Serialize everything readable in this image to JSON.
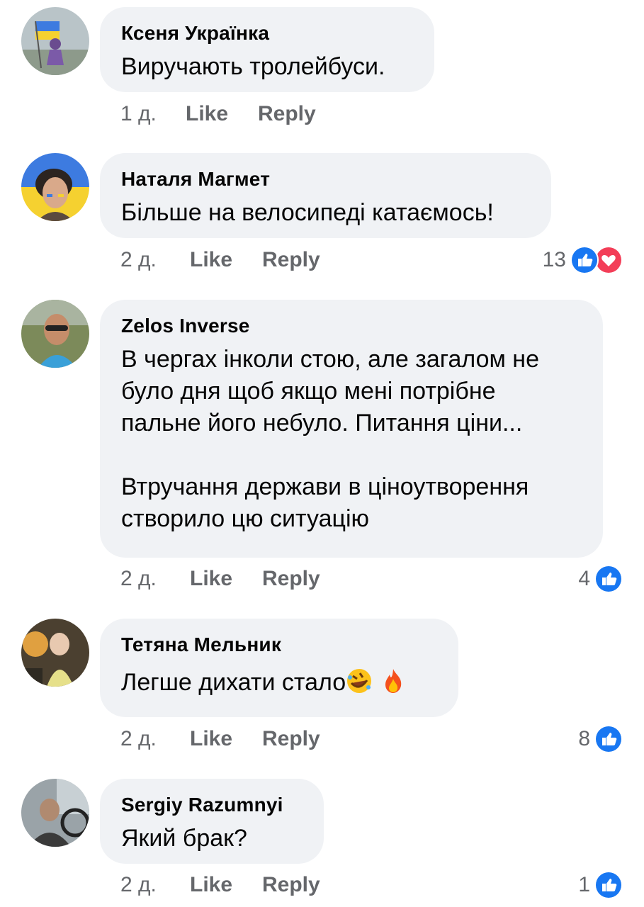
{
  "comments": [
    {
      "author": "Ксеня Українка",
      "lines": [
        "Виручають тролейбуси."
      ],
      "time": "1 д.",
      "like": "Like",
      "reply": "Reply",
      "reaction_count": ""
    },
    {
      "author": "Наталя Магмет",
      "lines": [
        "Більше на велосипеді катаємось!"
      ],
      "time": "2 д.",
      "like": "Like",
      "reply": "Reply",
      "reaction_count": "13"
    },
    {
      "author": "Zelos Inverse",
      "lines": [
        "В чергах інколи стою, але загалом не",
        "було дня щоб якщо мені потрібне",
        "пальне його небуло. Питання ціни...",
        "",
        "Втручання держави в ціноутворення",
        "створило цю ситуацію"
      ],
      "time": "2 д.",
      "like": "Like",
      "reply": "Reply",
      "reaction_count": "4"
    },
    {
      "author": "Тетяна Мельник",
      "lines": [
        "Легше дихати стало"
      ],
      "time": "2 д.",
      "like": "Like",
      "reply": "Reply",
      "reaction_count": "8",
      "emojis": [
        "rolling-laughing-emoji",
        "fire-emoji"
      ]
    },
    {
      "author": "Sergiy Razumnyi",
      "lines": [
        "Який брак?"
      ],
      "time": "2 д.",
      "like": "Like",
      "reply": "Reply",
      "reaction_count": "1"
    }
  ],
  "icons": {
    "like_reaction": "like-reaction-icon",
    "love_reaction": "love-reaction-icon"
  },
  "colors": {
    "bubble": "#f0f2f5",
    "meta_text": "#65676b",
    "like_blue": "#1877f2",
    "love_red": "#f33e58"
  }
}
